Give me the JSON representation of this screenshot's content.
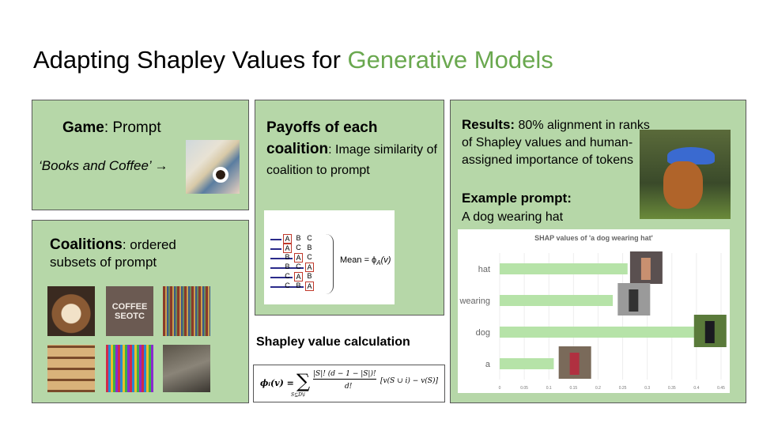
{
  "title": {
    "prefix": "Adapting Shapley Values for ",
    "highlight": "Generative Models"
  },
  "colors": {
    "accent": "#6aa84f",
    "panel": "#b6d7a8",
    "bar": "#b6e3a8"
  },
  "game": {
    "label": "Game",
    "text": ": Prompt",
    "prompt": "‘Books and Coffee’",
    "arrow": "→"
  },
  "coalitions": {
    "label": "Coalitions",
    "text": ": ordered subsets of prompt"
  },
  "payoffs": {
    "label": "Payoffs of each coalition",
    "text": ": Image similarity of coalition to prompt"
  },
  "diagram": {
    "rows": [
      [
        "A",
        "B",
        "C"
      ],
      [
        "A",
        "C",
        "B"
      ],
      [
        "B",
        "A",
        "C"
      ],
      [
        "B",
        "C",
        "A"
      ],
      [
        "C",
        "A",
        "B"
      ],
      [
        "C",
        "B",
        "A"
      ]
    ],
    "mean_label": "Mean = ϕ",
    "mean_sub": "A",
    "mean_tail": "(v)"
  },
  "shapley": {
    "heading": "Shapley value calculation",
    "formula_lhs": "ϕᵢ(v) = ",
    "sum": "∑",
    "sum_sub": "S⊆D\\i",
    "num": "|S|! (d − 1 − |S|)!",
    "den": "d!",
    "tail": "[v(S ∪ i) − v(S)]"
  },
  "results": {
    "label": "Results:",
    "text": " 80% alignment in ranks of Shapley values and human-assigned importance of tokens",
    "example_label": "Example prompt",
    "example_colon": ":",
    "example": "A dog wearing hat"
  },
  "chart_data": {
    "type": "bar",
    "orientation": "horizontal",
    "title": "SHAP values of 'a dog wearing hat'",
    "categories": [
      "hat",
      "wearing",
      "dog",
      "a"
    ],
    "values": [
      0.26,
      0.23,
      0.4,
      0.11
    ],
    "xlim": [
      0,
      0.45
    ],
    "xticks": [
      "0",
      "0.05",
      "0.1",
      "0.15",
      "0.2",
      "0.25",
      "0.3",
      "0.35",
      "0.4",
      "0.45"
    ],
    "grid": true
  }
}
